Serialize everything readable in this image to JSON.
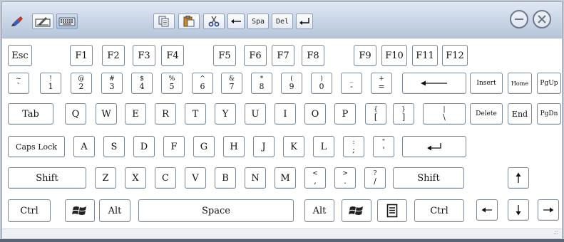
{
  "toolbar": {
    "left_icons": [
      "pen-tool-icon",
      "handwriting-pad-icon",
      "keyboard-icon"
    ],
    "actions": [
      {
        "name": "copy-button",
        "icon": "copy-icon"
      },
      {
        "name": "paste-button",
        "icon": "paste-icon"
      },
      {
        "name": "cut-button",
        "icon": "scissors-icon"
      },
      {
        "name": "backspace-button",
        "icon": "backspace-arrow-icon"
      },
      {
        "name": "space-button",
        "label": "Spa"
      },
      {
        "name": "delete-button",
        "label": "Del"
      },
      {
        "name": "enter-button",
        "icon": "enter-arrow-icon"
      }
    ],
    "window_controls": [
      "minimize-icon",
      "close-icon"
    ]
  },
  "keys": {
    "esc": "Esc",
    "f1": "F1",
    "f2": "F2",
    "f3": "F3",
    "f4": "F4",
    "f5": "F5",
    "f6": "F6",
    "f7": "F7",
    "f8": "F8",
    "f9": "F9",
    "f10": "F10",
    "f11": "F11",
    "f12": "F12",
    "insert": "Insert",
    "home": "Home",
    "pgup": "PgUp",
    "delete": "Delete",
    "end": "End",
    "pgdn": "PgDn",
    "tab": "Tab",
    "caps": "Caps Lock",
    "shift": "Shift",
    "ctrl": "Ctrl",
    "alt": "Alt",
    "space": "Space",
    "q": "Q",
    "w": "W",
    "e": "E",
    "r": "R",
    "t": "T",
    "y": "Y",
    "u": "U",
    "i": "I",
    "o": "O",
    "p": "P",
    "a": "A",
    "s": "S",
    "d": "D",
    "f": "F",
    "g": "G",
    "h": "H",
    "j": "J",
    "k": "K",
    "l": "L",
    "z": "Z",
    "x": "X",
    "c": "C",
    "v": "V",
    "b": "B",
    "n": "N",
    "m": "M",
    "backtick": {
      "up": "~",
      "down": "`"
    },
    "n1": {
      "up": "!",
      "down": "1"
    },
    "n2": {
      "up": "@",
      "down": "2"
    },
    "n3": {
      "up": "#",
      "down": "3"
    },
    "n4": {
      "up": "$",
      "down": "4"
    },
    "n5": {
      "up": "%",
      "down": "5"
    },
    "n6": {
      "up": "^",
      "down": "6"
    },
    "n7": {
      "up": "&",
      "down": "7"
    },
    "n8": {
      "up": "*",
      "down": "8"
    },
    "n9": {
      "up": "(",
      "down": "9"
    },
    "n0": {
      "up": ")",
      "down": "0"
    },
    "minus": {
      "up": "_",
      "down": "-"
    },
    "equal": {
      "up": "+",
      "down": "="
    },
    "lbracket": {
      "up": "{",
      "down": "["
    },
    "rbracket": {
      "up": "}",
      "down": "]"
    },
    "backslash": {
      "up": "|",
      "down": "\\"
    },
    "semicolon": {
      "up": ":",
      "down": ";"
    },
    "quote": {
      "up": "\"",
      "down": "'"
    },
    "comma": {
      "up": "<",
      "down": ","
    },
    "period": {
      "up": ">",
      "down": "."
    },
    "slash": {
      "up": "?",
      "down": "/"
    }
  },
  "icons": {
    "backspace": "left-arrow-icon",
    "enter": "enter-arrow-icon",
    "windows": "windows-logo-icon",
    "menu": "context-menu-icon",
    "arrow_up": "arrow-up-icon",
    "arrow_down": "arrow-down-icon",
    "arrow_left": "arrow-left-icon",
    "arrow_right": "arrow-right-icon",
    "resize_grip": "resize-grip-icon"
  },
  "colors": {
    "titlebar": "#c9d5e6",
    "key_border": "#7b8794",
    "key_fill": "#ffffff",
    "close_icon": "#6c7888"
  }
}
